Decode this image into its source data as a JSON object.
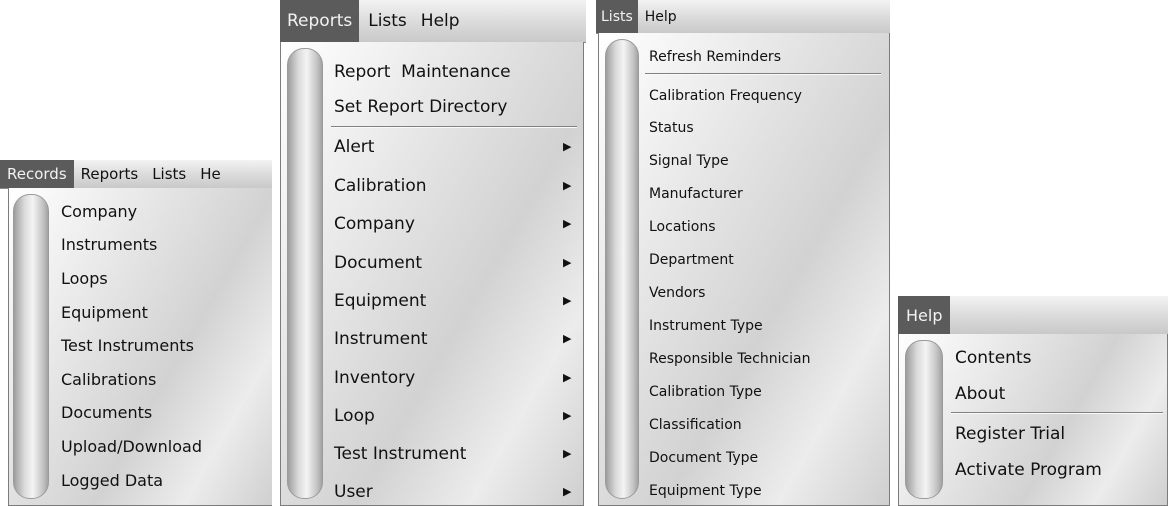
{
  "panel1": {
    "menubar": [
      "Records",
      "Reports",
      "Lists",
      "He"
    ],
    "items": [
      "Company",
      "Instruments",
      "Loops",
      "Equipment",
      "Test Instruments",
      "Calibrations",
      "Documents",
      "Upload/Download",
      "Logged Data"
    ]
  },
  "panel2": {
    "menubar": [
      "Reports",
      "Lists",
      "Help"
    ],
    "top_items": [
      "Report  Maintenance",
      "Set Report Directory"
    ],
    "submenus": [
      "Alert",
      "Calibration",
      "Company",
      "Document",
      "Equipment",
      "Instrument",
      "Inventory",
      "Loop",
      "Test Instrument",
      "User"
    ],
    "arrow_glyph": "▶"
  },
  "panel3": {
    "menubar": [
      "Lists",
      "Help"
    ],
    "top_items": [
      "Refresh Reminders"
    ],
    "items": [
      "Calibration Frequency",
      "Status",
      "Signal Type",
      "Manufacturer",
      "Locations",
      "Department",
      "Vendors",
      "Instrument Type",
      "Responsible Technician",
      "Calibration Type",
      "Classification",
      "Document Type",
      "Equipment Type"
    ]
  },
  "panel4": {
    "menubar": [
      "Help"
    ],
    "top_items": [
      "Contents",
      "About"
    ],
    "items": [
      "Register Trial",
      "Activate Program"
    ]
  },
  "colors": {
    "active_menu_bg": "#5b5b5b",
    "active_menu_fg": "#f2f2f2",
    "separator": "#808080"
  }
}
